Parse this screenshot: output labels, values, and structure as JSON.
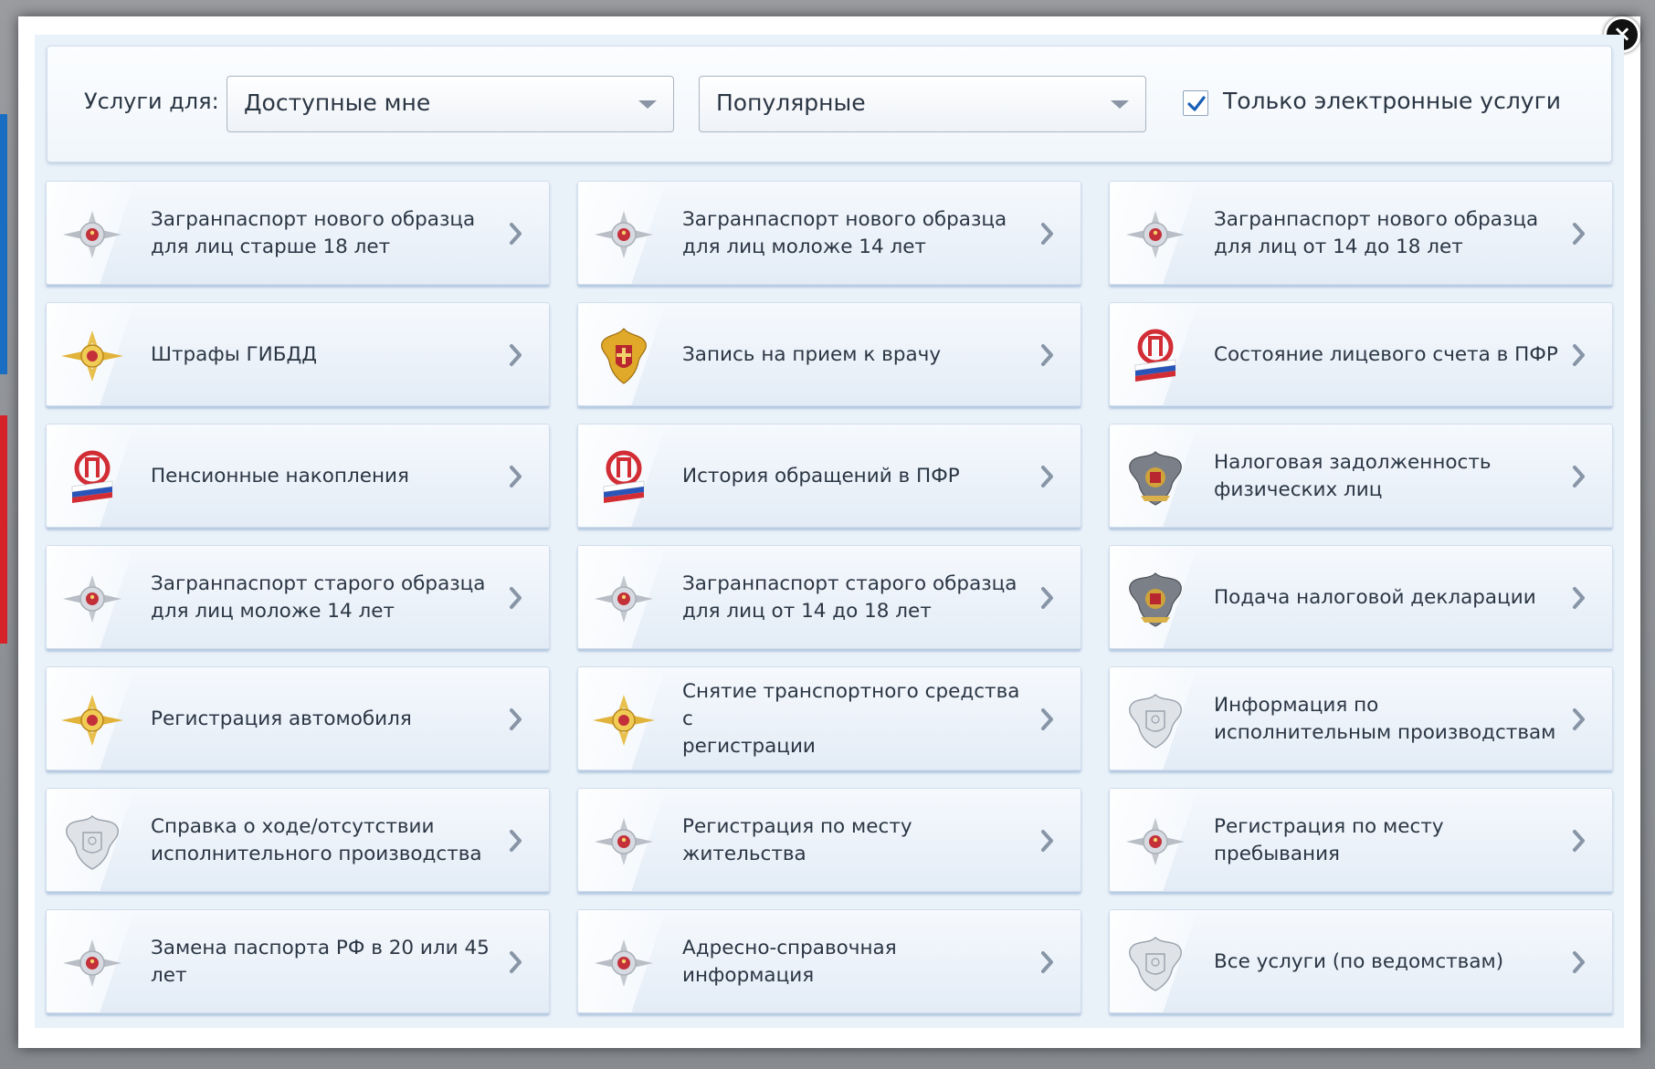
{
  "filter": {
    "label": "Услуги для:",
    "audience_select": "Доступные мне",
    "category_select": "Популярные",
    "electronic_only_label": "Только электронные услуги",
    "electronic_only_checked": true
  },
  "close_icon": "close-icon",
  "colors": {
    "accent": "#1a6fc4",
    "tile_bg": "#eaf1f8",
    "text": "#2b3644"
  },
  "services": [
    {
      "label": "Загранпаспорт нового образца\nдля лиц старше 18 лет",
      "icon": "mvd-emblem-icon"
    },
    {
      "label": "Загранпаспорт нового образца\nдля лиц моложе 14 лет",
      "icon": "mvd-emblem-icon"
    },
    {
      "label": "Загранпаспорт нового образца\nдля лиц от 14 до 18 лет",
      "icon": "mvd-emblem-icon"
    },
    {
      "label": "Штрафы ГИБДД",
      "icon": "gibdd-emblem-icon"
    },
    {
      "label": "Запись на прием к врачу",
      "icon": "health-emblem-icon"
    },
    {
      "label": "Состояние лицевого счета в ПФР",
      "icon": "pfr-logo-icon"
    },
    {
      "label": "Пенсионные накопления",
      "icon": "pfr-logo-icon"
    },
    {
      "label": "История обращений в ПФР",
      "icon": "pfr-logo-icon"
    },
    {
      "label": "Налоговая задолженность\nфизических лиц",
      "icon": "tax-emblem-icon"
    },
    {
      "label": "Загранпаспорт старого образца\nдля лиц моложе 14 лет",
      "icon": "mvd-emblem-icon"
    },
    {
      "label": "Загранпаспорт старого образца\nдля лиц от 14 до 18 лет",
      "icon": "mvd-emblem-icon"
    },
    {
      "label": "Подача налоговой декларации",
      "icon": "tax-emblem-icon"
    },
    {
      "label": "Регистрация автомобиля",
      "icon": "gibdd-emblem-icon"
    },
    {
      "label": "Снятие транспортного средства с\nрегистрации",
      "icon": "gibdd-emblem-icon"
    },
    {
      "label": "Информация по\nисполнительным производствам",
      "icon": "fssp-emblem-icon"
    },
    {
      "label": "Справка о ходе/отсутствии\nисполнительного производства",
      "icon": "fssp-emblem-icon"
    },
    {
      "label": "Регистрация по месту жительства",
      "icon": "mvd-emblem-icon"
    },
    {
      "label": "Регистрация по месту\nпребывания",
      "icon": "mvd-emblem-icon"
    },
    {
      "label": "Замена паспорта РФ в 20 или 45\nлет",
      "icon": "mvd-emblem-icon"
    },
    {
      "label": "Адресно-справочная\nинформация",
      "icon": "mvd-emblem-icon"
    },
    {
      "label": "Все услуги (по ведомствам)",
      "icon": "fssp-emblem-icon"
    }
  ]
}
